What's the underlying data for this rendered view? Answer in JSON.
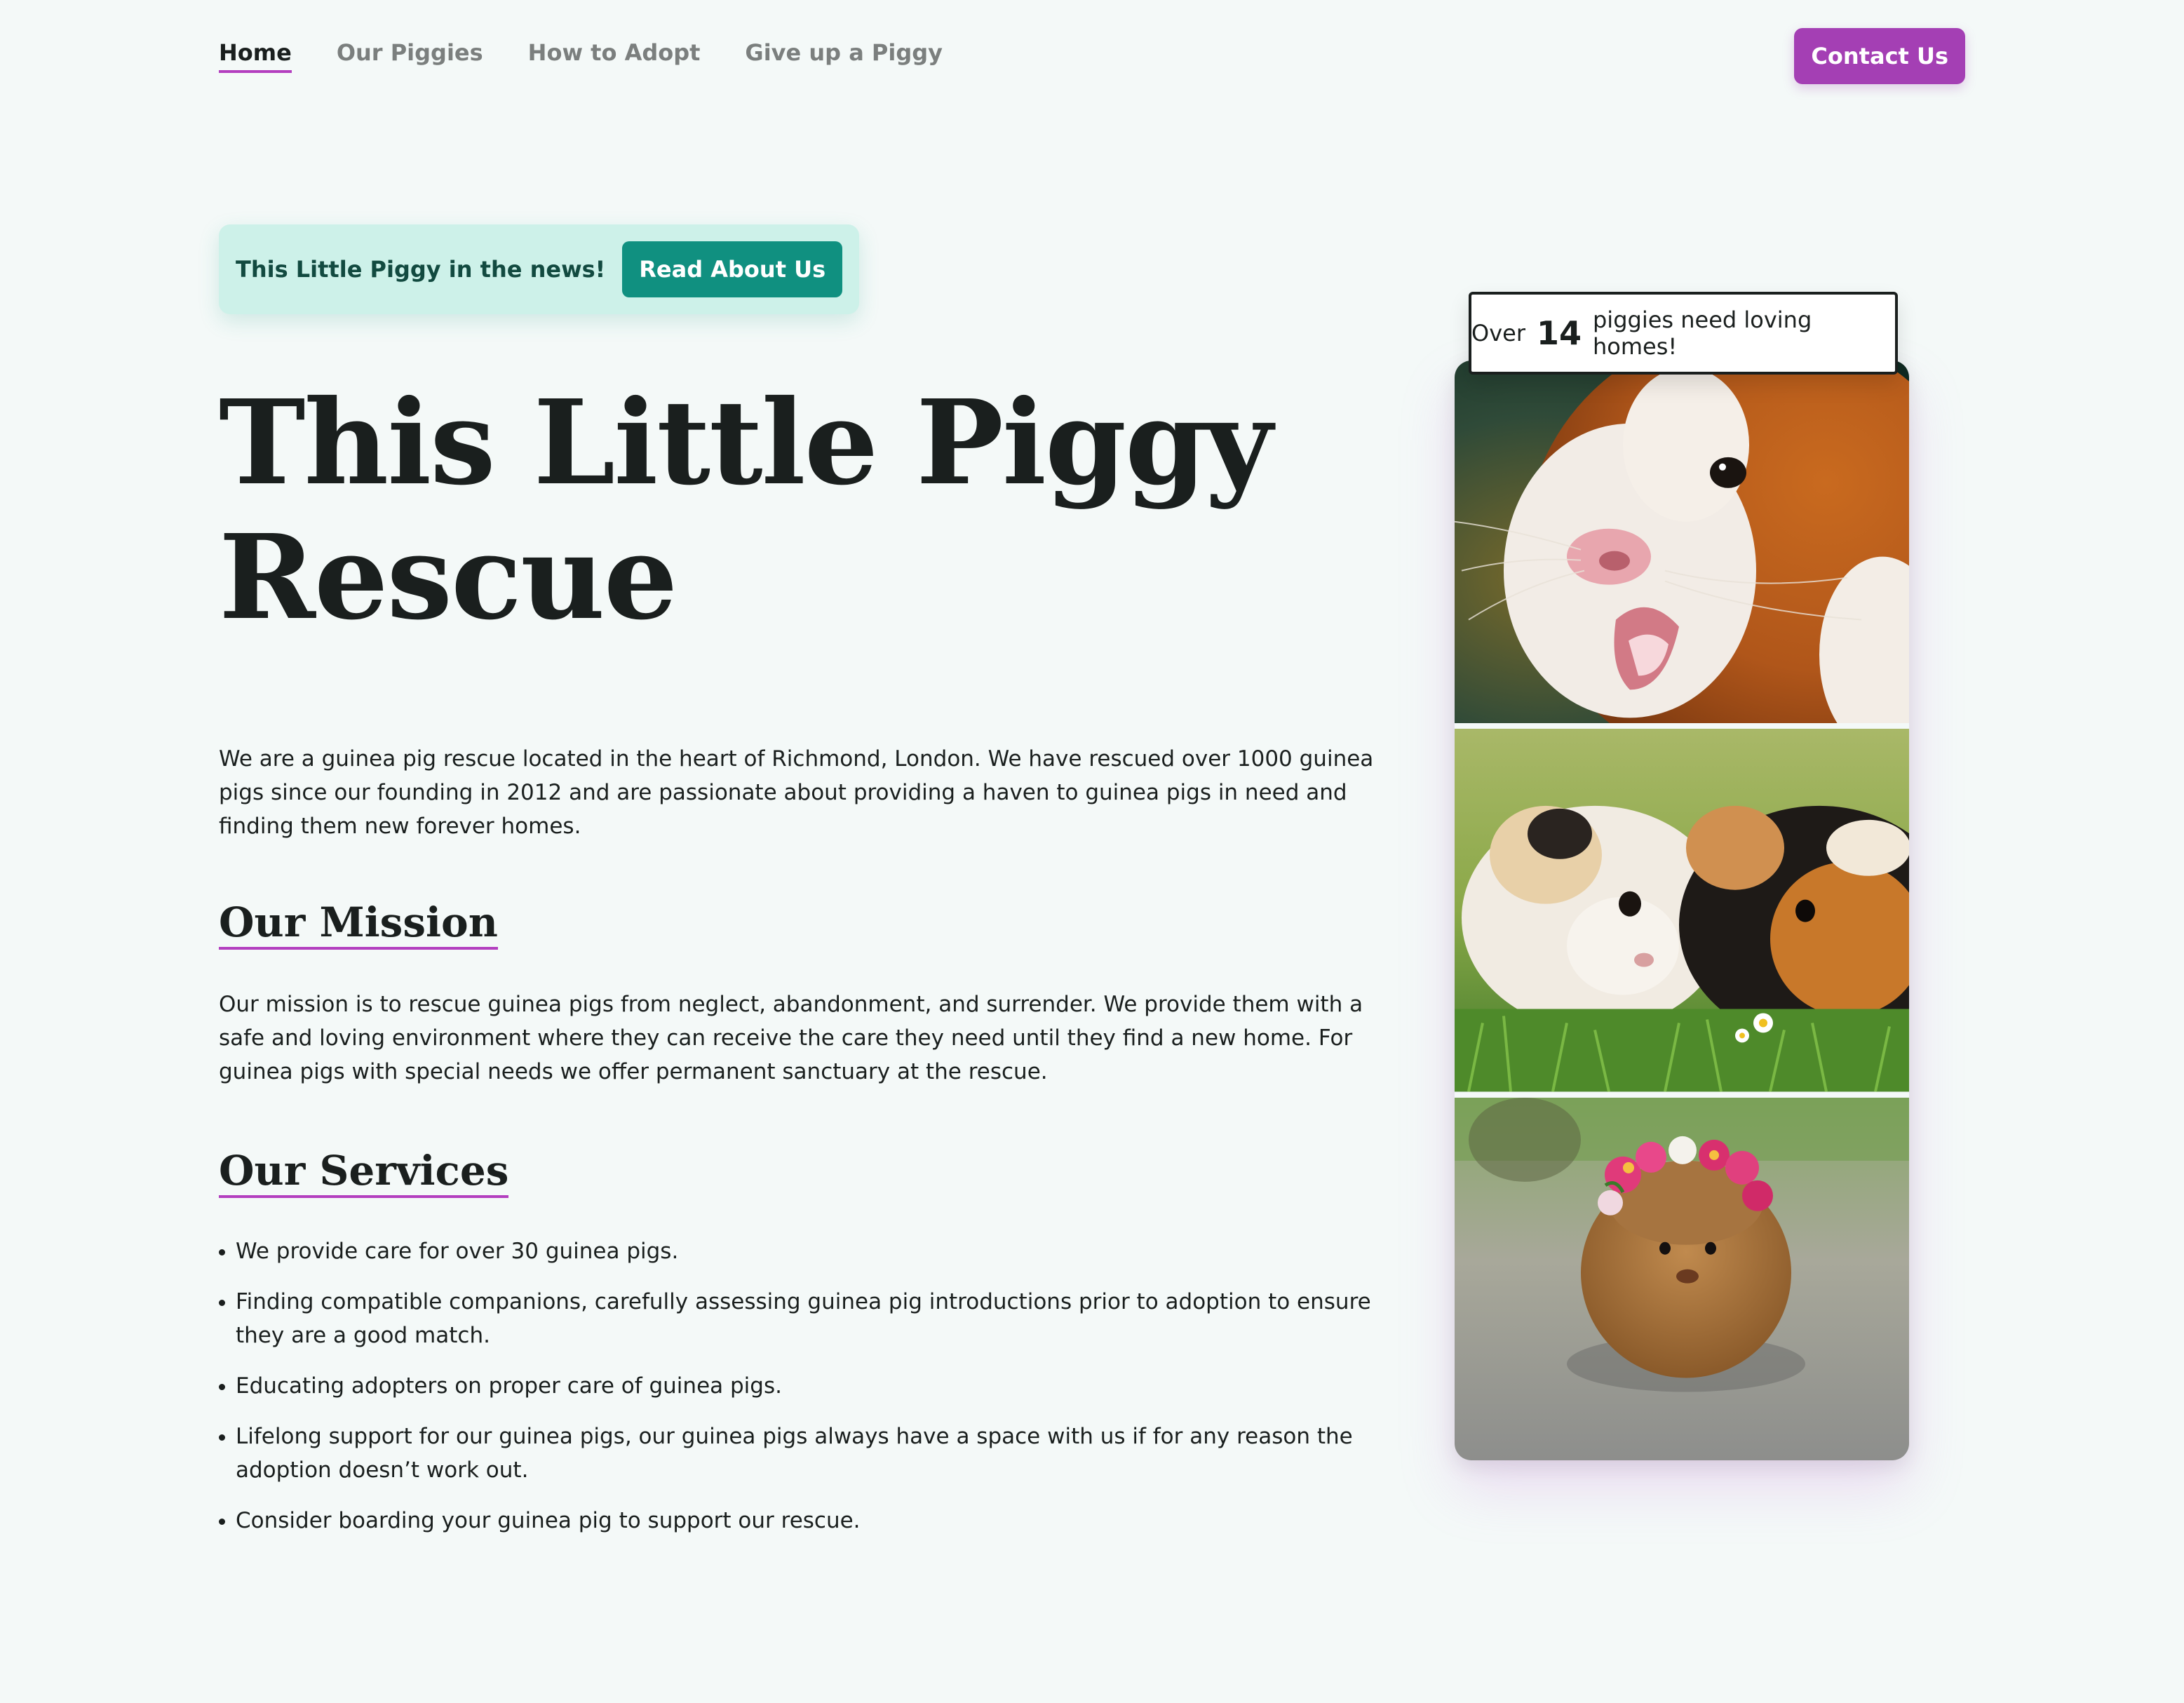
{
  "nav": {
    "links": [
      {
        "label": "Home",
        "active": true
      },
      {
        "label": "Our Piggies",
        "active": false
      },
      {
        "label": "How to Adopt",
        "active": false
      },
      {
        "label": "Give up a Piggy",
        "active": false
      }
    ],
    "contact_label": "Contact Us"
  },
  "news": {
    "text": "This Little Piggy in the news!",
    "button_label": "Read About Us"
  },
  "hero": {
    "title_line1": "This Little Piggy",
    "title_line2": "Rescue"
  },
  "intro": "We are a guinea pig rescue located in the heart of Richmond, London. We have rescued over 1000 guinea pigs since our founding in 2012 and are passionate about providing a haven to guinea pigs in need and finding them new forever homes.",
  "mission": {
    "heading": "Our Mission",
    "text": "Our mission is to rescue guinea pigs from neglect, abandonment, and surrender. We provide them with a safe and loving environment where they can receive the care they need until they find a new home. For guinea pigs with special needs we offer permanent sanctuary at the rescue."
  },
  "services": {
    "heading": "Our Services",
    "items": [
      "We provide care for over 30 guinea pigs.",
      "Finding compatible companions, carefully assessing guinea pig introductions prior to adoption to ensure they are a good match.",
      "Educating adopters on proper care of guinea pigs.",
      "Lifelong support for our guinea pigs, our guinea pigs always have a space with us if for any reason the adoption doesn’t work out.",
      "Consider boarding your guinea pig to support our rescue."
    ]
  },
  "badge": {
    "pre": "Over",
    "count": "14",
    "post": "piggies need loving homes!"
  },
  "gallery": {
    "photos": [
      "guinea-pig-closeup-photo",
      "two-guinea-pigs-grass-photo",
      "guinea-pig-flower-crown-photo"
    ]
  },
  "colors": {
    "background": "#f4f9f8",
    "accent_purple": "#a43fb4",
    "underline_purple": "#b33fbf",
    "teal_button": "#109080",
    "news_bg": "#cdf1e9",
    "text_dark": "#1a1f1e",
    "nav_muted": "#7b7f7e"
  }
}
